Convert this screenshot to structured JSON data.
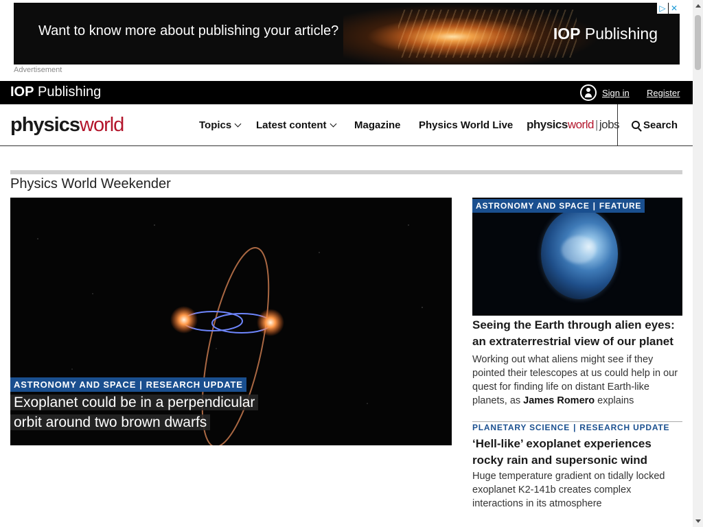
{
  "ad": {
    "headline": "Want to know more about publishing your article?",
    "brand_bold": "IOP",
    "brand_rest": " Publishing",
    "label": "Advertisement",
    "icon_info": "▷",
    "icon_close": "✕"
  },
  "iop_bar": {
    "logo_bold": "IOP",
    "logo_rest": " Publishing",
    "sign_in": "Sign in",
    "register": "Register"
  },
  "nav": {
    "logo_a": "physics",
    "logo_b": "world",
    "items": [
      "Topics",
      "Latest content",
      "Magazine",
      "Physics World Live"
    ],
    "jobs_a": "physics",
    "jobs_b": "world",
    "jobs_c": "jobs",
    "search": "Search"
  },
  "section": {
    "title": "Physics World Weekender"
  },
  "hero": {
    "tag1": "ASTRONOMY AND SPACE",
    "tag2": "RESEARCH UPDATE",
    "title": "Exoplanet could be in a perpendicular orbit around two brown dwarfs"
  },
  "card1": {
    "tag1": "ASTRONOMY AND SPACE",
    "tag2": "FEATURE",
    "title": "Seeing the Earth through alien eyes: an extraterrestrial view of our planet",
    "text_before": "Working out what aliens might see if they pointed their telescopes at us could help in our quest for finding life on distant Earth-like planets, as ",
    "text_author": "James Romero",
    "text_after": " explains"
  },
  "card2": {
    "tag1": "PLANETARY SCIENCE",
    "tag2": "RESEARCH UPDATE",
    "title": "‘Hell-like’ exoplanet experiences rocky rain and supersonic wind",
    "text": "Huge temperature gradient on tidally locked exoplanet K2-141b creates complex interactions in its atmosphere"
  },
  "colors": {
    "brand_red": "#b3152b",
    "tag_blue": "#1a4f8f",
    "bar_black": "#000000"
  }
}
